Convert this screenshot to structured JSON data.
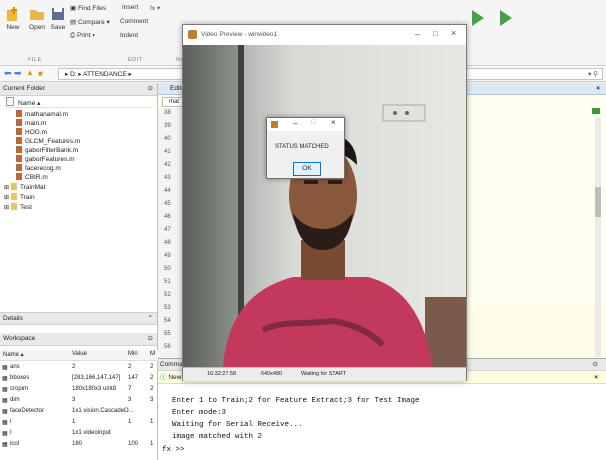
{
  "toolstrip": {
    "new_label": "New",
    "open_label": "Open",
    "save_label": "Save",
    "find_files": "Find Files",
    "compare": "Compare",
    "print": "Print",
    "insert": "Insert",
    "comment": "Comment",
    "indent": "Indent",
    "fx": "fx",
    "group_file": "FILE",
    "group_edit": "EDIT",
    "group_nav": "NA"
  },
  "address": {
    "path_root": "D:",
    "path_folder": "ATTENDANCE",
    "sep": "▸"
  },
  "current_folder": {
    "title": "Current Folder",
    "name_col": "Name ▴",
    "files": [
      "mathanamal.m",
      "main.m",
      "HOG.m",
      "GLCM_Features.m",
      "gaborFilterBank.m",
      "gaborFeatures.m",
      "facerecog.m",
      "CBIR.m",
      "TrainMat",
      "Train",
      "Test"
    ]
  },
  "details": {
    "title": "Details"
  },
  "workspace": {
    "title": "Workspace",
    "columns": [
      "Name ▴",
      "Value",
      "Min",
      "M"
    ],
    "rows": [
      {
        "name": "ans",
        "value": "2",
        "min": "2",
        "max": "2"
      },
      {
        "name": "bboxes",
        "value": "[283,166,147,147]",
        "min": "147",
        "max": "2"
      },
      {
        "name": "cropim",
        "value": "180x180x3 uint8",
        "min": "7",
        "max": "2"
      },
      {
        "name": "dim",
        "value": "3",
        "min": "3",
        "max": "3"
      },
      {
        "name": "faceDetector",
        "value": "1x1 vision.CascadeO...",
        "min": "",
        "max": ""
      },
      {
        "name": "i",
        "value": "1",
        "min": "1",
        "max": "1"
      },
      {
        "name": "I",
        "value": "1x1 videoinput",
        "min": "",
        "max": ""
      },
      {
        "name": "icol",
        "value": "180",
        "min": "100",
        "max": "1"
      }
    ]
  },
  "editor": {
    "title": "Editor",
    "tab": "mat",
    "line_numbers": [
      "38",
      "39",
      "40",
      "41",
      "42",
      "43",
      "44",
      "45",
      "46",
      "47",
      "48",
      "49",
      "50",
      "51",
      "52",
      "53",
      "54",
      "55",
      "56"
    ]
  },
  "command": {
    "title": "Command",
    "new_link": "New t",
    "lines": [
      "Enter 1 to Train;2 for Feature Extract;3 for Test Image",
      "Enter mode:3",
      "Waiting for Serial Receive...",
      "image matched with   2"
    ],
    "prompt": "fx >>"
  },
  "video": {
    "title": "Video Preview - winvideo1",
    "status_time": "16:32:27.58",
    "status_res": "640x480",
    "status_msg": "Waiting for START"
  },
  "dialog": {
    "message": "STATUS MATCHED",
    "ok_label": "OK"
  },
  "colors": {
    "accent": "#0078d7",
    "editor_bg": "#fffde8"
  }
}
